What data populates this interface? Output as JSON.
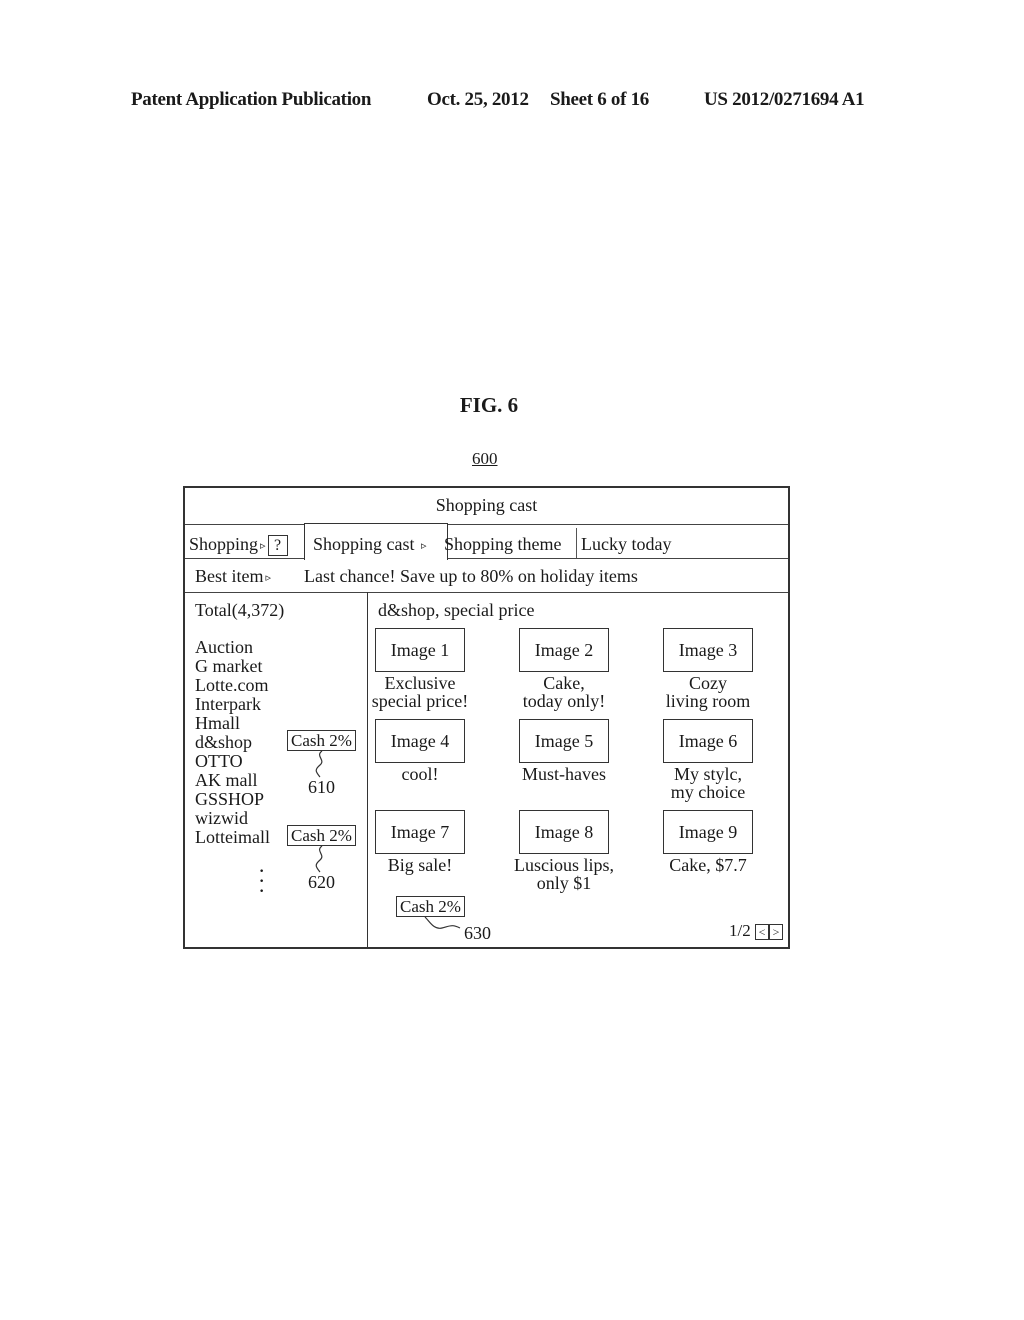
{
  "header": {
    "publication": "Patent Application Publication",
    "date": "Oct. 25, 2012",
    "sheet": "Sheet 6 of 16",
    "patent_number": "US 2012/0271694 A1"
  },
  "figure": {
    "label": "FIG. 6",
    "reference": "600"
  },
  "screen": {
    "title": "Shopping cast",
    "tabs": [
      {
        "label": "Shopping",
        "has_arrow": true,
        "has_help": true,
        "active": false
      },
      {
        "label": "Shopping cast",
        "has_arrow": true,
        "active": true
      },
      {
        "label": "Shopping theme",
        "active": false
      },
      {
        "label": "Lucky today",
        "active": false
      }
    ],
    "help_symbol": "?",
    "arrow_symbol": "▹",
    "best_item": {
      "label": "Best item",
      "text": "Last chance! Save up to 80% on holiday items"
    },
    "left_pane": {
      "total": "Total(4,372)",
      "malls": [
        "Auction",
        "G market",
        "Lotte.com",
        "Interpark",
        "Hmall",
        "d&shop",
        "OTTO",
        "AK mall",
        "GSSHOP",
        "wizwid",
        "Lotteimall"
      ],
      "cash_badges": [
        {
          "mall": "d&shop",
          "label": "Cash 2%",
          "reference": "610"
        },
        {
          "mall": "Lotteimall",
          "label": "Cash 2%",
          "reference": "620"
        }
      ],
      "ellipsis": "⋮"
    },
    "right_pane": {
      "title": "d&shop, special price",
      "items": [
        {
          "image": "Image 1",
          "caption": "Exclusive\nspecial price!"
        },
        {
          "image": "Image 2",
          "caption": "Cake,\ntoday only!"
        },
        {
          "image": "Image 3",
          "caption": "Cozy\nliving room"
        },
        {
          "image": "Image 4",
          "caption": "cool!"
        },
        {
          "image": "Image 5",
          "caption": "Must-haves"
        },
        {
          "image": "Image 6",
          "caption": "My stylc,\nmy choice"
        },
        {
          "image": "Image 7",
          "caption": "Big sale!"
        },
        {
          "image": "Image 8",
          "caption": "Luscious lips,\nonly $1"
        },
        {
          "image": "Image 9",
          "caption": "Cake, $7.7"
        }
      ],
      "cash_badge": {
        "label": "Cash 2%",
        "reference": "630"
      },
      "pager": {
        "text": "1/2",
        "prev": "<",
        "next": ">"
      }
    }
  }
}
